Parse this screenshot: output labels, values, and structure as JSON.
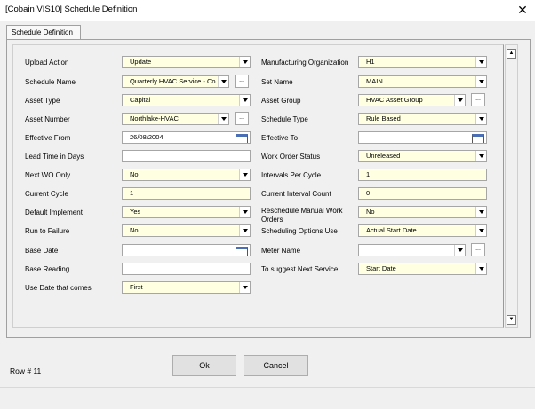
{
  "window": {
    "title": "[Cobain VIS10] Schedule Definition",
    "close_glyph": "✕"
  },
  "tab": {
    "label": "Schedule Definition"
  },
  "left_fields": [
    {
      "label": "Upload Action",
      "value": "Update",
      "control": "dropdown"
    },
    {
      "label": "Schedule Name",
      "value": "Quarterly HVAC Service - Co",
      "control": "dropdown-ellipsis"
    },
    {
      "label": "Asset Type",
      "value": "Capital",
      "control": "dropdown"
    },
    {
      "label": "Asset Number",
      "value": "Northlake-HVAC",
      "control": "dropdown-ellipsis"
    },
    {
      "label": "Effective From",
      "value": "26/08/2004",
      "control": "date"
    },
    {
      "label": "Lead Time in Days",
      "value": "",
      "control": "text"
    },
    {
      "label": "Next WO Only",
      "value": "No",
      "control": "dropdown"
    },
    {
      "label": "Current Cycle",
      "value": "1",
      "control": "text-yellow"
    },
    {
      "label": "Default Implement",
      "value": "Yes",
      "control": "dropdown"
    },
    {
      "label": "Run to Failure",
      "value": "No",
      "control": "dropdown"
    },
    {
      "label": "Base Date",
      "value": "",
      "control": "date"
    },
    {
      "label": "Base Reading",
      "value": "",
      "control": "text"
    },
    {
      "label": "Use Date that comes",
      "value": "First",
      "control": "dropdown"
    }
  ],
  "right_fields": [
    {
      "label": "Manufacturing Organization",
      "value": "H1",
      "control": "dropdown"
    },
    {
      "label": "Set Name",
      "value": "MAIN",
      "control": "dropdown"
    },
    {
      "label": "Asset Group",
      "value": "HVAC Asset Group",
      "control": "dropdown-ellipsis"
    },
    {
      "label": "Schedule Type",
      "value": "Rule Based",
      "control": "dropdown"
    },
    {
      "label": "Effective To",
      "value": "",
      "control": "date"
    },
    {
      "label": "Work Order Status",
      "value": "Unreleased",
      "control": "dropdown"
    },
    {
      "label": "Intervals Per Cycle",
      "value": "1",
      "control": "text-yellow"
    },
    {
      "label": "Current Interval Count",
      "value": "0",
      "control": "text-yellow"
    },
    {
      "label": "Reschedule Manual Work Orders",
      "value": "No",
      "control": "dropdown"
    },
    {
      "label": "Scheduling Options Use",
      "value": "Actual Start Date",
      "control": "dropdown"
    },
    {
      "label": "Meter Name",
      "value": "",
      "control": "dropdown-ellipsis-white"
    },
    {
      "label": "To suggest Next Service",
      "value": "Start Date",
      "control": "dropdown"
    }
  ],
  "ellipsis_glyph": "...",
  "scroll": {
    "up": "▲",
    "down": "▼"
  },
  "buttons": {
    "ok": "Ok",
    "cancel": "Cancel"
  },
  "status": {
    "row_label": "Row # 11"
  }
}
